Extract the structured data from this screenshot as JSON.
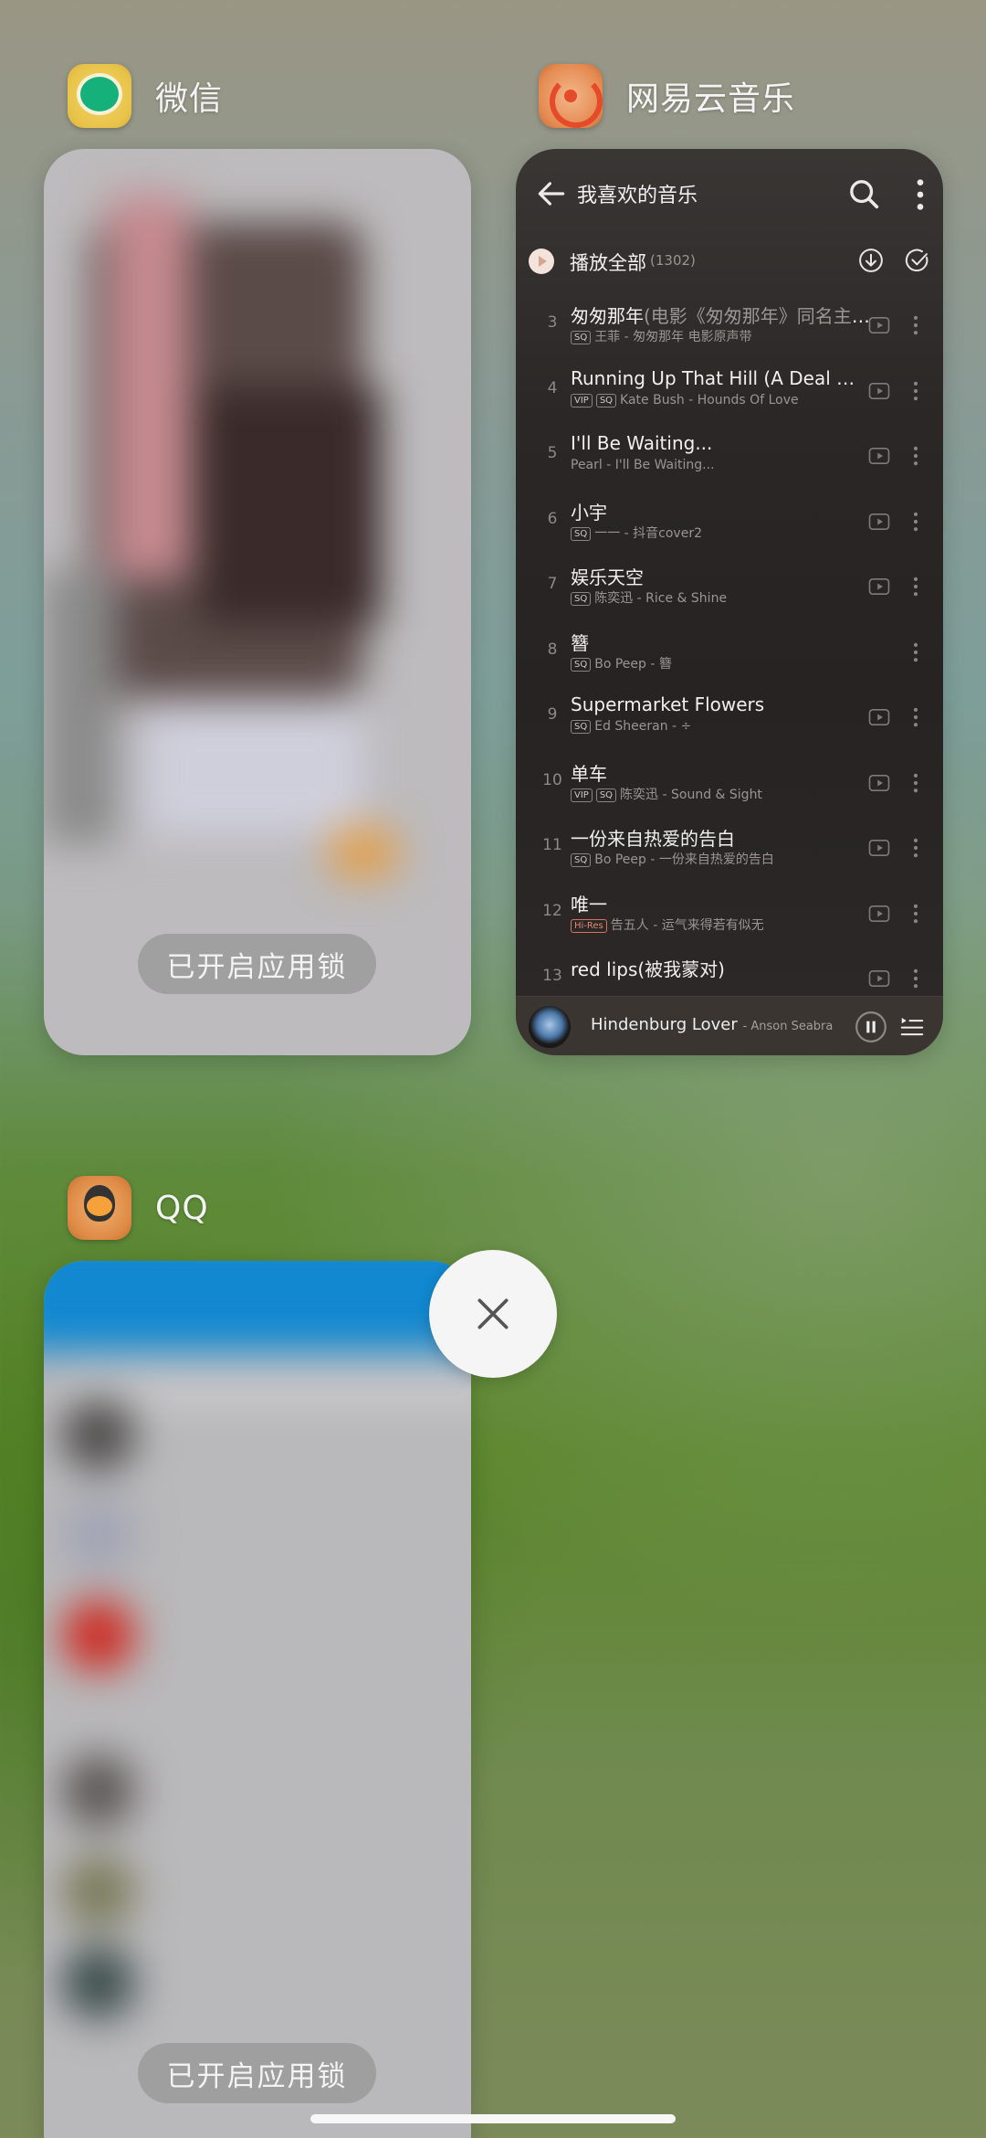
{
  "apps": [
    {
      "name": "微信",
      "icon": "wechat-app-icon",
      "lock_label": "已开启应用锁"
    },
    {
      "name": "网易云音乐",
      "icon": "netease-music-app-icon"
    },
    {
      "name": "QQ",
      "icon": "qq-app-icon",
      "lock_label": "已开启应用锁"
    }
  ],
  "music": {
    "page_title": "我喜欢的音乐",
    "play_all": "播放全部",
    "play_all_count": "(1302)",
    "songs": [
      {
        "num": "3",
        "title": "匆匆那年",
        "note": "(电影《匆匆那年》同名主题曲)",
        "badges": [
          "SQ"
        ],
        "sub": "王菲 - 匆匆那年 电影原声带",
        "has_play": true
      },
      {
        "num": "4",
        "title": "Running Up That Hill (A Deal With God) (…",
        "note": "",
        "badges": [
          "VIP",
          "SQ"
        ],
        "sub": "Kate Bush - Hounds Of Love",
        "has_play": true
      },
      {
        "num": "5",
        "title": "I'll Be Waiting...",
        "note": "",
        "badges": [],
        "sub": "Pearl - I'll Be Waiting...",
        "has_play": true
      },
      {
        "num": "6",
        "title": "小宇",
        "note": "",
        "badges": [
          "SQ"
        ],
        "sub": "一一 - 抖音cover2",
        "has_play": true
      },
      {
        "num": "7",
        "title": "娱乐天空",
        "note": "",
        "badges": [
          "SQ"
        ],
        "sub": "陈奕迅 - Rice & Shine",
        "has_play": true
      },
      {
        "num": "8",
        "title": "簪",
        "note": "",
        "badges": [
          "SQ"
        ],
        "sub": "Bo Peep - 簪",
        "has_play": false
      },
      {
        "num": "9",
        "title": "Supermarket Flowers",
        "note": "",
        "badges": [
          "SQ"
        ],
        "sub": "Ed Sheeran - ÷",
        "has_play": true
      },
      {
        "num": "10",
        "title": "单车",
        "note": "",
        "badges": [
          "VIP",
          "SQ"
        ],
        "sub": "陈奕迅 - Sound & Sight",
        "has_play": true
      },
      {
        "num": "11",
        "title": "一份来自热爱的告白",
        "note": "",
        "badges": [
          "SQ"
        ],
        "sub": "Bo Peep - 一份来自热爱的告白",
        "has_play": true
      },
      {
        "num": "12",
        "title": "唯一",
        "note": "",
        "badges": [
          "Hi-Res"
        ],
        "sub": "告五人 - 运气来得若有似无",
        "has_play": true
      },
      {
        "num": "13",
        "title": "red lips(被我蒙对)",
        "note": "",
        "badges": [],
        "sub": "",
        "has_play": true
      }
    ],
    "player": {
      "title": "Hindenburg Lover",
      "artist": "- Anson Seabra"
    }
  },
  "close_label": "close-all"
}
